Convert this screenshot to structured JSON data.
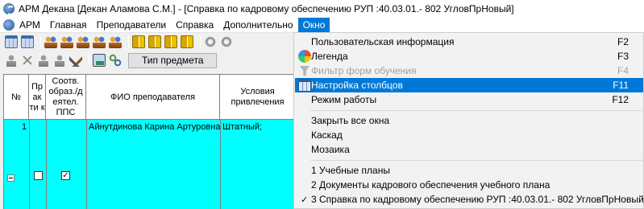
{
  "window": {
    "title": "АРМ Декана [Декан Аламова С.М.] - [Справка по кадровому обеспечению РУП :40.03.01.- 802 УгловПрНовый]"
  },
  "menubar": {
    "items": [
      {
        "label": "АРМ",
        "active": false
      },
      {
        "label": "Главная",
        "active": false
      },
      {
        "label": "Преподаватели",
        "active": false
      },
      {
        "label": "Справка",
        "active": false
      },
      {
        "label": "Дополнительно",
        "active": false
      },
      {
        "label": "Окно",
        "active": true
      }
    ]
  },
  "toolbar": {
    "type_button_label": "Тип предмета"
  },
  "grid": {
    "headers": {
      "num": "№",
      "pr": "Пр ак ти к",
      "sootv": "Соотв. образ./д еятел. ППС",
      "fio": "ФИО преподавателя",
      "usl": "Условия привлечения"
    },
    "row": {
      "num": "1",
      "fio": "Айнутдинова Карина Артуровна",
      "usl": "Штатный;",
      "sootv_checked": true
    }
  },
  "window_menu": {
    "items": [
      {
        "label": "Пользовательская информация",
        "shortcut": "F2",
        "icon": "none",
        "disabled": false,
        "selected": false
      },
      {
        "label": "Легенда",
        "shortcut": "F3",
        "icon": "legend-icon",
        "disabled": false,
        "selected": false
      },
      {
        "label": "Фильтр форм обучения",
        "shortcut": "F4",
        "icon": "filter-icon",
        "disabled": true,
        "selected": false
      },
      {
        "label": "Настройка столбцов",
        "shortcut": "F11",
        "icon": "columns-icon",
        "disabled": false,
        "selected": true
      },
      {
        "label": "Режим работы",
        "shortcut": "F12",
        "icon": "none",
        "disabled": false,
        "selected": false
      }
    ],
    "window_items": [
      {
        "label": "Закрыть все окна"
      },
      {
        "label": "Каскад"
      },
      {
        "label": "Мозаика"
      }
    ],
    "open_windows": [
      {
        "label": "1 Учебные планы",
        "checked": false
      },
      {
        "label": "2 Документы кадрового обеспечения учебного плана",
        "checked": false
      },
      {
        "label": "3 Справка по кадровому обеспечению РУП :40.03.01.- 802 УгловПрНовый",
        "checked": true
      }
    ],
    "check_glyph": "✓"
  },
  "colors": {
    "grid_row_bg": "#00ffff",
    "menu_selection": "#0078d7",
    "menu_bg": "#f2f2f2"
  }
}
